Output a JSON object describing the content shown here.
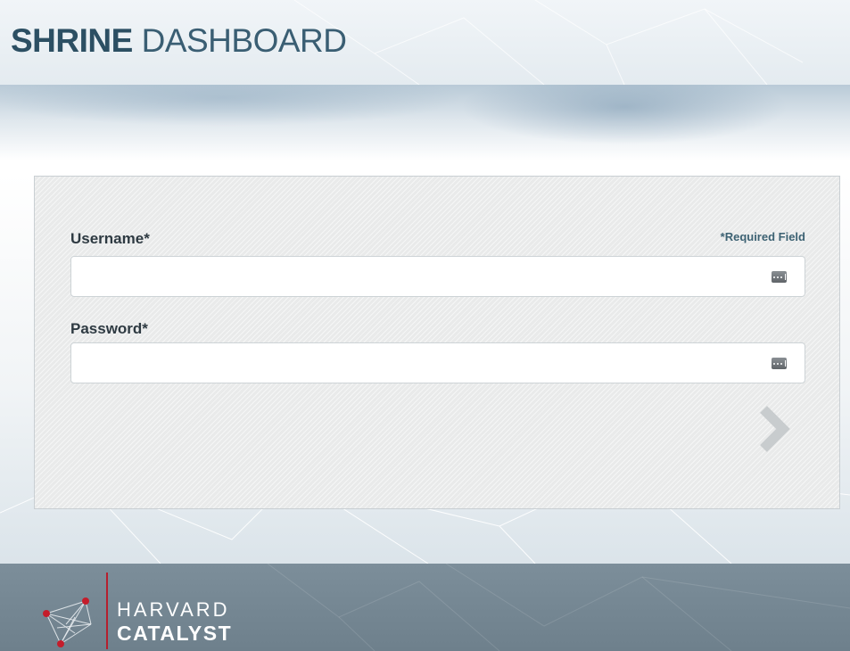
{
  "header": {
    "title_bold": "SHRINE",
    "title_light": "DASHBOARD"
  },
  "login_form": {
    "username_label": "Username*",
    "password_label": "Password*",
    "required_note": "*Required Field",
    "username_value": "",
    "password_value": "",
    "submit_icon": "chevron-right-icon",
    "field_icon": "password-manager-key-icon"
  },
  "footer": {
    "brand_line1": "HARVARD",
    "brand_line2": "CATALYST",
    "logo_icon": "harvard-catalyst-network-icon"
  },
  "colors": {
    "title": "#2c4f63",
    "footer_bg": "#7c8e9a",
    "accent_red": "#b51f2e",
    "panel_bg": "#e9eaea",
    "required_note": "#3d6273"
  }
}
